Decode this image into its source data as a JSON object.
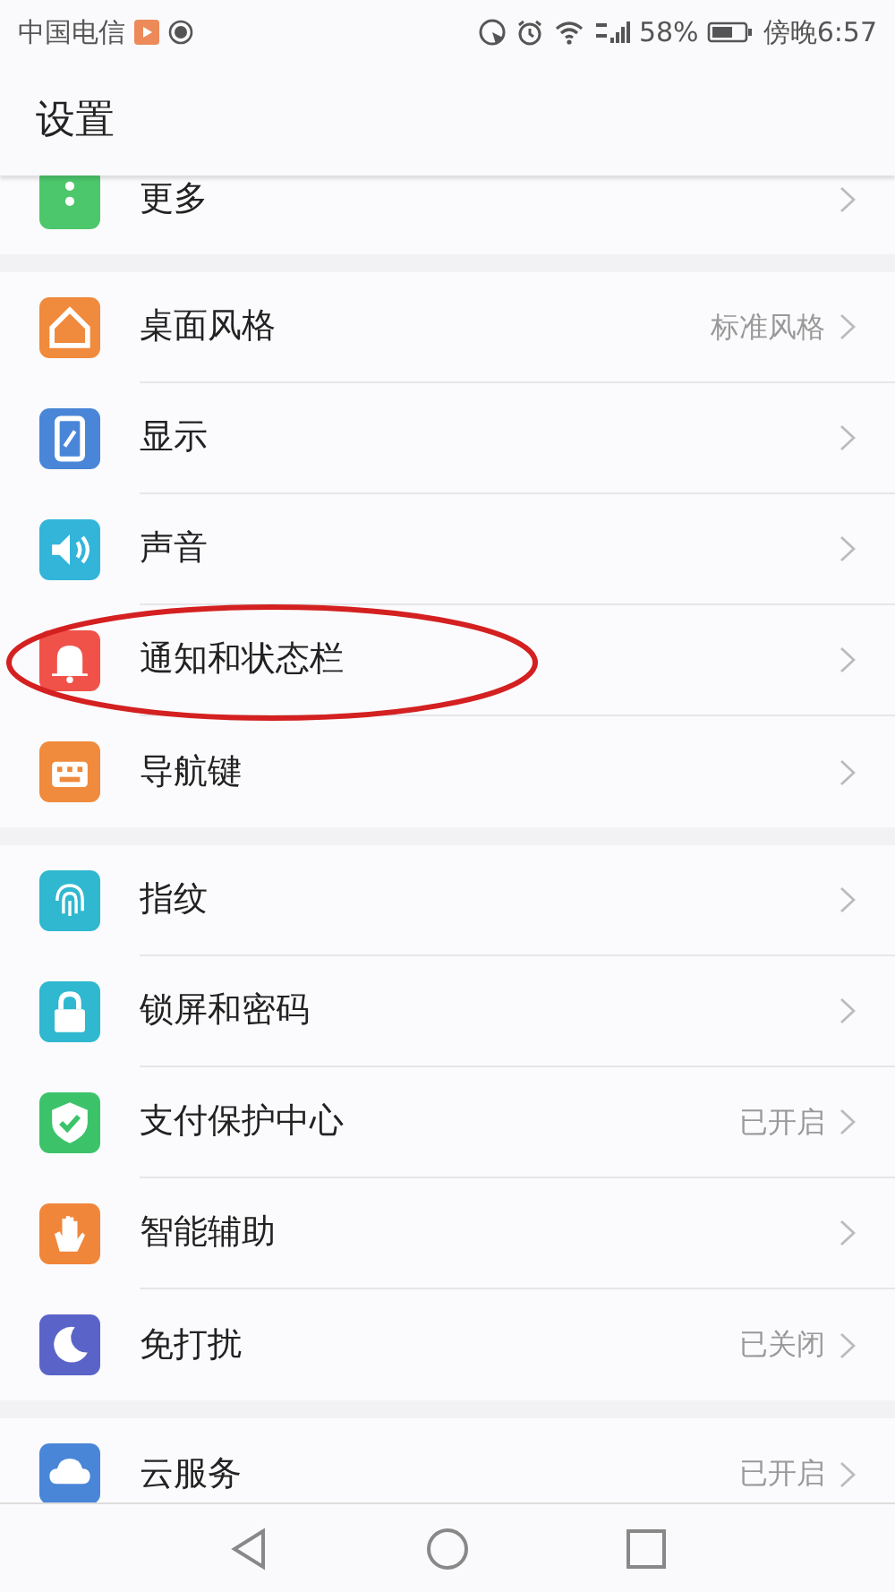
{
  "status_bar": {
    "carrier": "中国电信",
    "battery": "58%",
    "time": "傍晚6:57"
  },
  "title": "设置",
  "groups": [
    [
      {
        "label": "更多",
        "color": "#4cc76b"
      }
    ],
    [
      {
        "label": "桌面风格",
        "value": "标准风格",
        "color": "#f08a3c"
      },
      {
        "label": "显示",
        "color": "#4a86d8"
      },
      {
        "label": "声音",
        "color": "#33b5d9"
      },
      {
        "label": "通知和状态栏",
        "color": "#f0524a",
        "highlighted": true
      },
      {
        "label": "导航键",
        "color": "#f08a3c"
      }
    ],
    [
      {
        "label": "指纹",
        "color": "#2fb8cf"
      },
      {
        "label": "锁屏和密码",
        "color": "#2fb8cf"
      },
      {
        "label": "支付保护中心",
        "value": "已开启",
        "color": "#3cc36a"
      },
      {
        "label": "智能辅助",
        "color": "#f0863a"
      },
      {
        "label": "免打扰",
        "value": "已关闭",
        "color": "#5a64c8"
      }
    ],
    [
      {
        "label": "云服务",
        "value": "已开启",
        "color": "#4a86d8"
      }
    ]
  ]
}
